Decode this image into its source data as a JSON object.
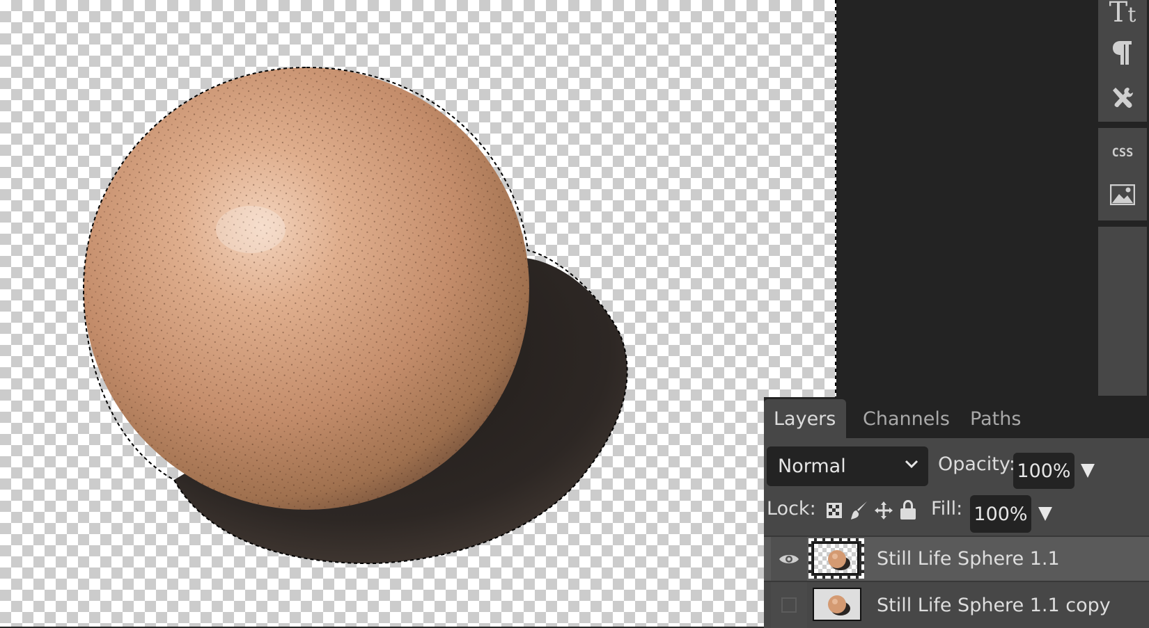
{
  "canvas": {
    "subject": "wooden sphere with cast shadow on transparent background",
    "selection": "marching-ants selection around sphere and shadow",
    "colors": {
      "checker_light": "#ffffff",
      "checker_dark": "#cccccc",
      "sphere_highlight": "#f1cfb6",
      "sphere_mid": "#c99576",
      "sphere_dark": "#7a563f",
      "shadow": "#2a2522"
    }
  },
  "right_toolbar": {
    "groups": [
      {
        "items": [
          {
            "icon": "text-size-icon",
            "glyph": "Tt"
          },
          {
            "icon": "paragraph-icon",
            "glyph": "¶"
          },
          {
            "icon": "tools-icon",
            "glyph": "wrench-screwdriver"
          }
        ]
      },
      {
        "items": [
          {
            "icon": "css-icon",
            "glyph": "CSS"
          },
          {
            "icon": "image-icon",
            "glyph": "picture"
          }
        ]
      },
      {
        "items": []
      }
    ]
  },
  "layers_panel": {
    "tabs": [
      {
        "label": "Layers",
        "active": true
      },
      {
        "label": "Channels",
        "active": false
      },
      {
        "label": "Paths",
        "active": false
      }
    ],
    "blend_mode": "Normal",
    "opacity_label": "Opacity:",
    "opacity_value": "100%",
    "lock_label": "Lock:",
    "lock_icons": [
      "lock-transparency-icon",
      "lock-paint-icon",
      "lock-move-icon",
      "lock-all-icon"
    ],
    "fill_label": "Fill:",
    "fill_value": "100%",
    "layers": [
      {
        "name": "Still Life Sphere 1.1",
        "visible": true,
        "selected": true
      },
      {
        "name": "Still Life Sphere 1.1 copy",
        "visible": false,
        "selected": false
      }
    ]
  }
}
